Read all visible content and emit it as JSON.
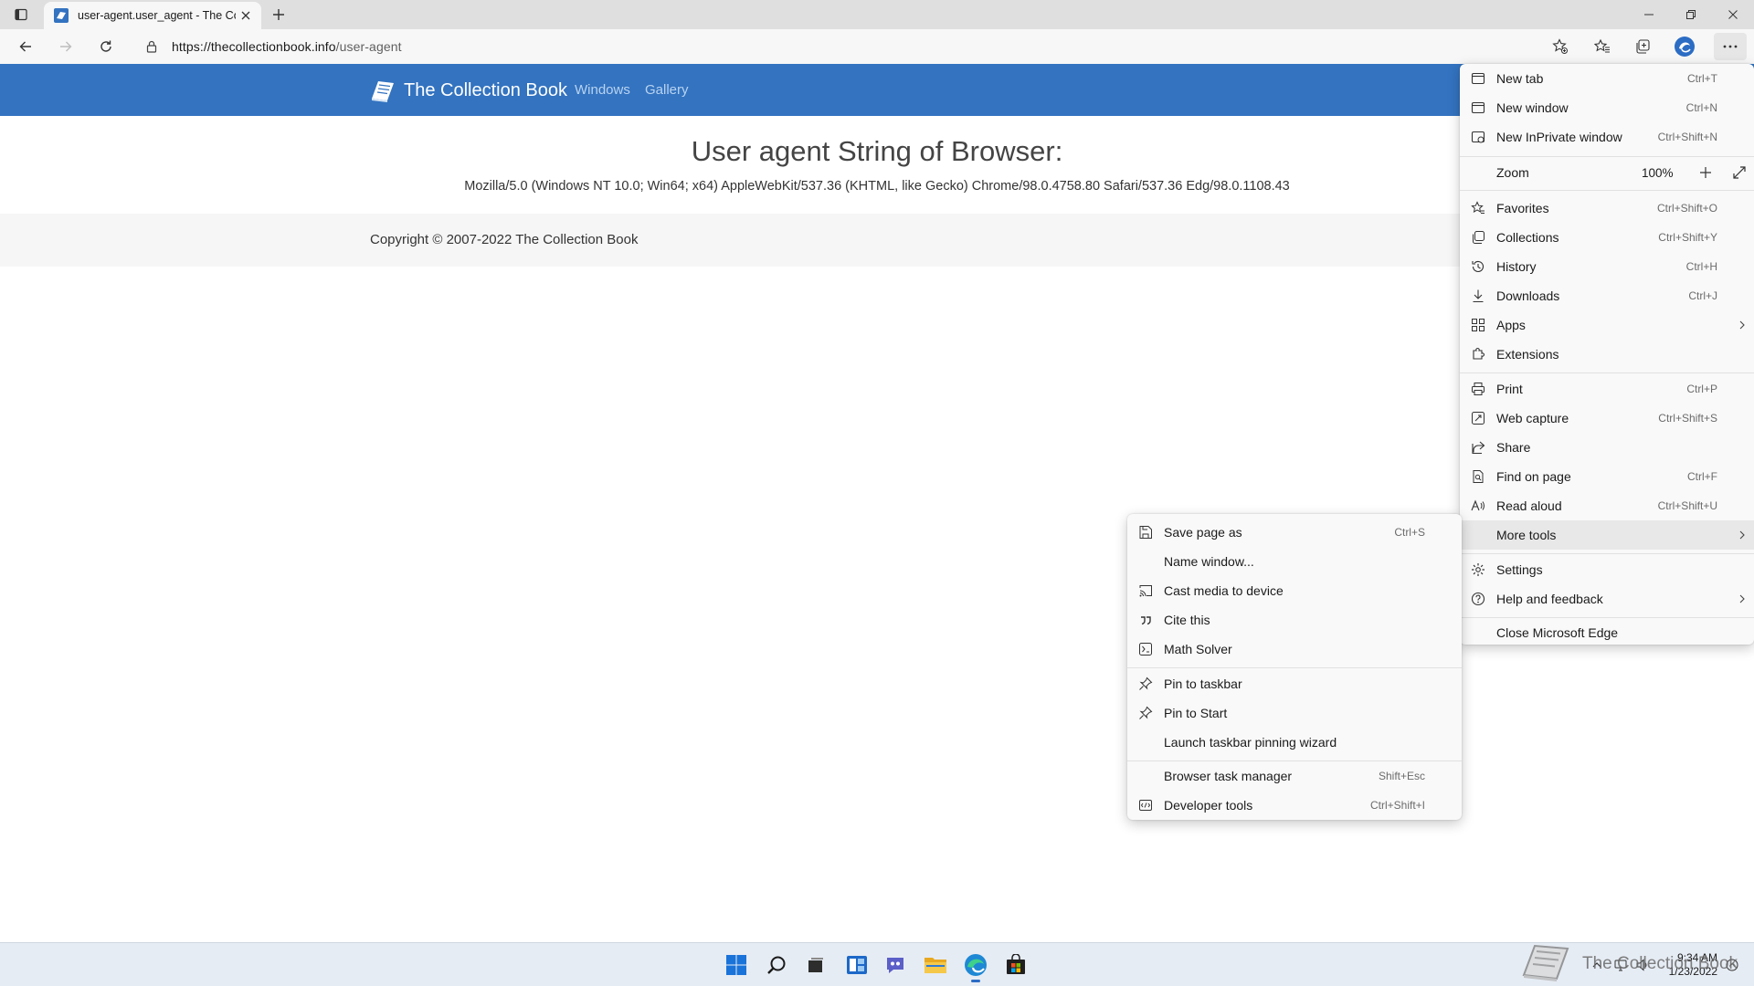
{
  "browser": {
    "tab": {
      "title": "user-agent.user_agent - The Coll",
      "favicon": "collection-book-icon"
    },
    "address": {
      "host": "https://thecollectionbook.info",
      "path": "/user-agent"
    }
  },
  "site": {
    "brand": "The Collection Book",
    "nav": [
      "Windows",
      "Gallery"
    ],
    "heading": "User agent String of Browser:",
    "user_agent": "Mozilla/5.0 (Windows NT 10.0; Win64; x64) AppleWebKit/537.36 (KHTML, like Gecko) Chrome/98.0.4758.80 Safari/537.36 Edg/98.0.1108.43",
    "copyright": "Copyright © 2007-2022 The Collection Book"
  },
  "main_menu": {
    "new_tab": {
      "label": "New tab",
      "shortcut": "Ctrl+T"
    },
    "new_window": {
      "label": "New window",
      "shortcut": "Ctrl+N"
    },
    "new_inprivate": {
      "label": "New InPrivate window",
      "shortcut": "Ctrl+Shift+N"
    },
    "zoom": {
      "label": "Zoom",
      "value": "100%"
    },
    "favorites": {
      "label": "Favorites",
      "shortcut": "Ctrl+Shift+O"
    },
    "collections": {
      "label": "Collections",
      "shortcut": "Ctrl+Shift+Y"
    },
    "history": {
      "label": "History",
      "shortcut": "Ctrl+H"
    },
    "downloads": {
      "label": "Downloads",
      "shortcut": "Ctrl+J"
    },
    "apps": {
      "label": "Apps"
    },
    "extensions": {
      "label": "Extensions"
    },
    "print": {
      "label": "Print",
      "shortcut": "Ctrl+P"
    },
    "web_capture": {
      "label": "Web capture",
      "shortcut": "Ctrl+Shift+S"
    },
    "share": {
      "label": "Share"
    },
    "find": {
      "label": "Find on page",
      "shortcut": "Ctrl+F"
    },
    "read_aloud": {
      "label": "Read aloud",
      "shortcut": "Ctrl+Shift+U"
    },
    "more_tools": {
      "label": "More tools"
    },
    "settings": {
      "label": "Settings"
    },
    "help": {
      "label": "Help and feedback"
    },
    "close": {
      "label": "Close Microsoft Edge"
    }
  },
  "more_tools_menu": {
    "save_page": {
      "label": "Save page as",
      "shortcut": "Ctrl+S"
    },
    "name_window": {
      "label": "Name window..."
    },
    "cast": {
      "label": "Cast media to device"
    },
    "cite": {
      "label": "Cite this"
    },
    "math": {
      "label": "Math Solver"
    },
    "pin_taskbar": {
      "label": "Pin to taskbar"
    },
    "pin_start": {
      "label": "Pin to Start"
    },
    "pin_wizard": {
      "label": "Launch taskbar pinning wizard"
    },
    "task_manager": {
      "label": "Browser task manager",
      "shortcut": "Shift+Esc"
    },
    "dev_tools": {
      "label": "Developer tools",
      "shortcut": "Ctrl+Shift+I"
    }
  },
  "taskbar": {
    "time": "9:34 AM",
    "date": "1/23/2022"
  },
  "watermark": "The Collection Book",
  "colors": {
    "site_nav": "#3373c0",
    "accent": "#2b6cc4"
  }
}
